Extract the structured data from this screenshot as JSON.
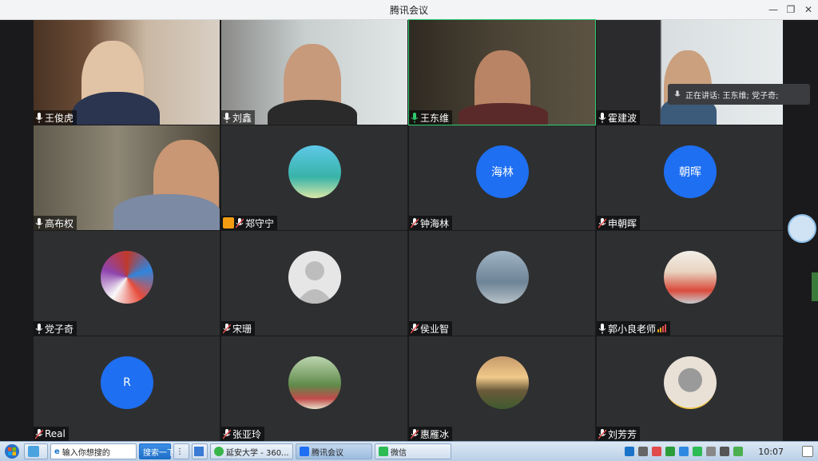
{
  "window": {
    "title": "腾讯会议",
    "minimize": "—",
    "restore": "❐",
    "close": "✕"
  },
  "speaking_toast": "正在讲话: 王东维; 党子奇;",
  "participants": [
    {
      "name": "王俊虎",
      "kind": "video",
      "muted": false
    },
    {
      "name": "刘鑫",
      "kind": "video",
      "muted": false
    },
    {
      "name": "王东维",
      "kind": "video",
      "muted": false,
      "speaking": true
    },
    {
      "name": "霍建波",
      "kind": "video",
      "muted": false
    },
    {
      "name": "高布权",
      "kind": "video",
      "muted": false
    },
    {
      "name": "郑守宁",
      "kind": "photo",
      "muted": true,
      "host_badge": true
    },
    {
      "name": "钟海林",
      "kind": "initials",
      "initials": "海林",
      "muted": true
    },
    {
      "name": "申朝晖",
      "kind": "initials",
      "initials": "朝晖",
      "muted": true
    },
    {
      "name": "党子奇",
      "kind": "photo",
      "muted": false
    },
    {
      "name": "宋珊",
      "kind": "photo",
      "muted": true
    },
    {
      "name": "侯业智",
      "kind": "photo",
      "muted": true
    },
    {
      "name": "郭小良老师",
      "kind": "photo",
      "muted": false,
      "signal_icon": true
    },
    {
      "name": "Real",
      "kind": "initials",
      "initials": "R",
      "muted": true
    },
    {
      "name": "张亚玲",
      "kind": "photo",
      "muted": true
    },
    {
      "name": "惠雁冰",
      "kind": "photo",
      "muted": true
    },
    {
      "name": "刘芳芳",
      "kind": "photo",
      "muted": true
    }
  ],
  "taskbar": {
    "search_placeholder": "输入你想搜的",
    "search_button": "搜索一下",
    "apps": [
      "延安大学 - 360...",
      "腾讯会议",
      "微信"
    ],
    "clock": "10:07"
  },
  "colors": {
    "accent_blue": "#1e6ff2",
    "tile_bg": "#2e2f31",
    "speaking_green": "#2ecc71",
    "muted_red": "#e04b4b"
  }
}
